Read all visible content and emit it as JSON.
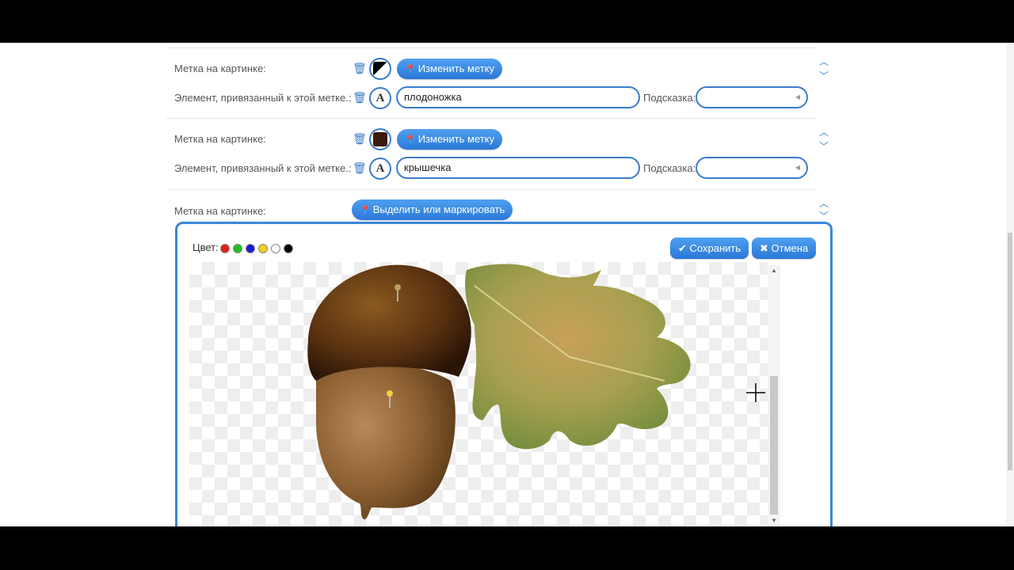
{
  "rows": [
    {
      "mark_label": "Метка на картинке:",
      "change_button": "Изменить метку",
      "element_label": "Элемент, привязанный к этой метке.:",
      "element_value": "плодоножка",
      "hint_label": "Подсказка:",
      "swatch_color": "#000000"
    },
    {
      "mark_label": "Метка на картинке:",
      "change_button": "Изменить метку",
      "element_label": "Элемент, привязанный к этой метке.:",
      "element_value": "крышечка",
      "hint_label": "Подсказка:",
      "swatch_color": "#3a1a08"
    },
    {
      "mark_label": "Метка на картинке:",
      "select_button": "Выделить или маркировать"
    }
  ],
  "letter_icon": "A",
  "modal": {
    "color_label": "Цвет:",
    "colors": [
      "#e02020",
      "#20c020",
      "#1a1ad0",
      "#f0d020",
      "#ffffff",
      "#000000"
    ],
    "save_button": "Сохранить",
    "cancel_button": "Отмена"
  }
}
